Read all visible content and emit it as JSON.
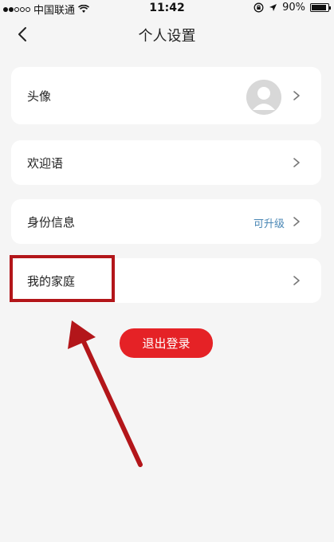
{
  "status_bar": {
    "carrier": "中国联通",
    "time": "11:42",
    "battery": "90%"
  },
  "nav": {
    "title": "个人设置"
  },
  "settings": {
    "avatar_label": "头像",
    "greeting_label": "欢迎语",
    "identity_label": "身份信息",
    "identity_badge": "可升级",
    "family_label": "我的家庭"
  },
  "logout_label": "退出登录",
  "colors": {
    "accent_red": "#e52226",
    "annotation_red": "#b3161a",
    "badge_blue": "#4a87b5"
  }
}
